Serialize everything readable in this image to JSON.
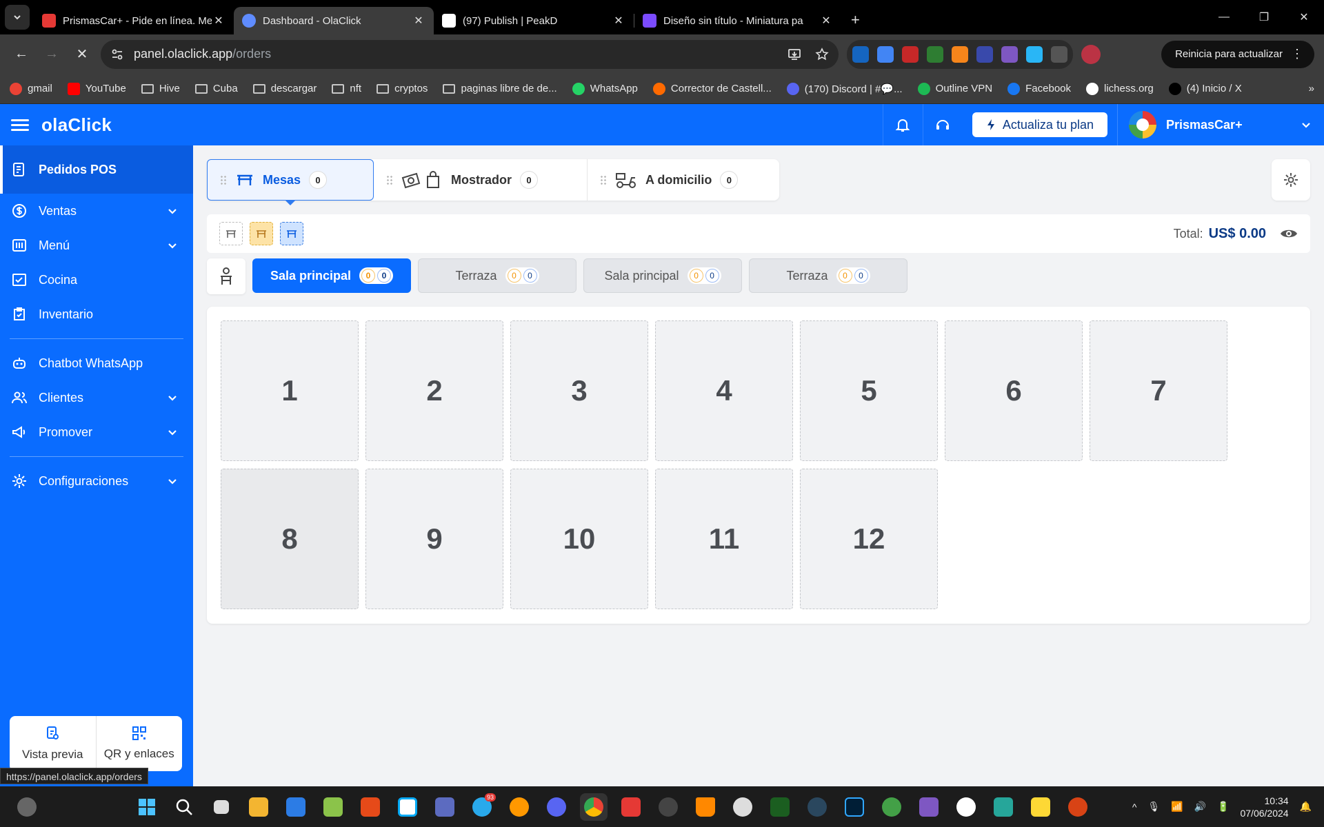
{
  "browser": {
    "tabs": [
      {
        "title": "PrismasCar+ - Pide en línea. Me",
        "favicon_color": "#e53935"
      },
      {
        "title": "Dashboard - OlaClick",
        "favicon_color": "#5f8cff",
        "active": true
      },
      {
        "title": "(97) Publish | PeakD",
        "favicon_color": "#ffffff"
      },
      {
        "title": "Diseño sin título - Miniatura pa",
        "favicon_color": "#7b4bff"
      }
    ],
    "url_host": "panel.olaclick.app",
    "url_path": "/orders",
    "update_label": "Reinicia para actualizar",
    "bookmarks": [
      {
        "label": "gmail",
        "icon": "gmail-icon",
        "color": "#ea4335"
      },
      {
        "label": "YouTube",
        "icon": "youtube-icon",
        "color": "#ff0000"
      },
      {
        "label": "Hive",
        "icon": "folder-icon"
      },
      {
        "label": "Cuba",
        "icon": "folder-icon"
      },
      {
        "label": "descargar",
        "icon": "folder-icon"
      },
      {
        "label": "nft",
        "icon": "folder-icon"
      },
      {
        "label": "cryptos",
        "icon": "folder-icon"
      },
      {
        "label": "paginas libre de de...",
        "icon": "folder-icon"
      },
      {
        "label": "WhatsApp",
        "icon": "whatsapp-icon",
        "color": "#25d366"
      },
      {
        "label": "Corrector de Castell...",
        "icon": "check-icon",
        "color": "#ff6a00"
      },
      {
        "label": "(170) Discord | #💬...",
        "icon": "discord-icon",
        "color": "#5865f2"
      },
      {
        "label": "Outline VPN",
        "icon": "vpn-icon",
        "color": "#1db954"
      },
      {
        "label": "Facebook",
        "icon": "facebook-icon",
        "color": "#1877f2"
      },
      {
        "label": "lichess.org",
        "icon": "lichess-icon",
        "color": "#ffffff"
      },
      {
        "label": "(4) Inicio / X",
        "icon": "x-icon",
        "color": "#000000"
      }
    ],
    "status_url": "https://panel.olaclick.app/orders"
  },
  "header": {
    "logo": "olaClick",
    "plan_button": "Actualiza tu plan",
    "account_name": "PrismasCar+"
  },
  "sidebar": {
    "items": [
      {
        "label": "Pedidos POS",
        "icon": "pos-orders-icon",
        "active": true
      },
      {
        "label": "Ventas",
        "icon": "dollar-icon",
        "expandable": true
      },
      {
        "label": "Menú",
        "icon": "menu-book-icon",
        "expandable": true
      },
      {
        "label": "Cocina",
        "icon": "kitchen-icon"
      },
      {
        "label": "Inventario",
        "icon": "inventory-icon"
      },
      {
        "label": "Chatbot WhatsApp",
        "icon": "chatbot-icon"
      },
      {
        "label": "Clientes",
        "icon": "users-icon",
        "expandable": true
      },
      {
        "label": "Promover",
        "icon": "megaphone-icon",
        "expandable": true
      },
      {
        "label": "Configuraciones",
        "icon": "gear-icon",
        "expandable": true
      }
    ],
    "preview_label": "Vista previa",
    "qr_label": "QR y enlaces"
  },
  "orders": {
    "tabs": [
      {
        "label": "Mesas",
        "count": "0",
        "active": true
      },
      {
        "label": "Mostrador",
        "count": "0"
      },
      {
        "label": "A domicilio",
        "count": "0"
      }
    ],
    "total_label": "Total:",
    "total_value": "US$ 0.00"
  },
  "rooms": [
    {
      "label": "Sala principal",
      "pending": "0",
      "active_count": "0",
      "active": true
    },
    {
      "label": "Terraza",
      "pending": "0",
      "active_count": "0"
    },
    {
      "label": "Sala principal",
      "pending": "0",
      "active_count": "0"
    },
    {
      "label": "Terraza",
      "pending": "0",
      "active_count": "0"
    }
  ],
  "tables": [
    "1",
    "2",
    "3",
    "4",
    "5",
    "6",
    "7",
    "8",
    "9",
    "10",
    "11",
    "12"
  ],
  "taskbar": {
    "time": "10:34",
    "date": "07/06/2024",
    "telegram_badge": "93"
  },
  "colors": {
    "brand": "#0a6cff",
    "accent_dark": "#0b3a86"
  }
}
